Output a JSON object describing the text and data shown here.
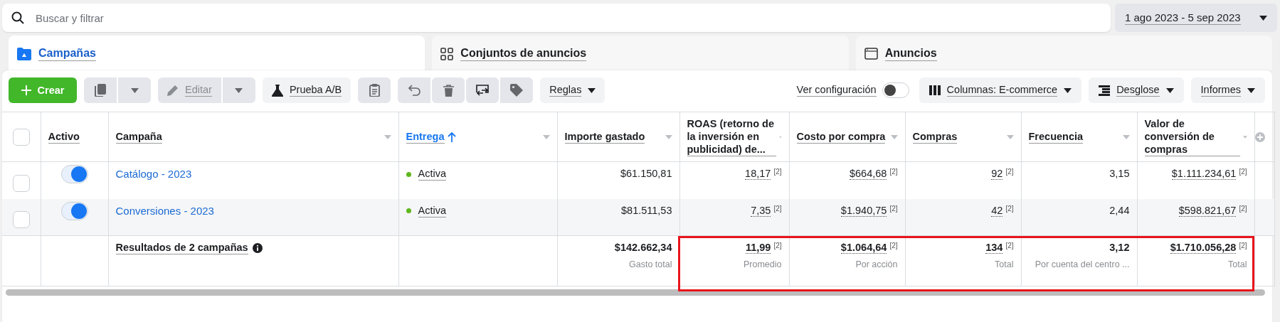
{
  "search": {
    "placeholder": "Buscar y filtrar"
  },
  "date_range": {
    "label": "1 ago 2023 - 5 sep 2023"
  },
  "tabs": [
    {
      "label": "Campañas",
      "selected": true
    },
    {
      "label": "Conjuntos de anuncios",
      "selected": false
    },
    {
      "label": "Anuncios",
      "selected": false
    }
  ],
  "toolbar": {
    "groups": [
      [
        {
          "kind": "create",
          "label": "Crear",
          "disabled": false
        }
      ],
      [
        {
          "kind": "copy",
          "disabled": true
        },
        {
          "kind": "dropdown",
          "disabled": true
        }
      ],
      [
        {
          "kind": "edit",
          "label": "Editar",
          "disabled": true
        },
        {
          "kind": "dropdown",
          "disabled": true
        }
      ],
      [
        {
          "kind": "test",
          "label": "Prueba A/B",
          "disabled": false
        }
      ],
      [
        {
          "kind": "clipboard",
          "disabled": true
        }
      ],
      [
        {
          "kind": "undo",
          "disabled": true
        },
        {
          "kind": "delete",
          "disabled": true
        },
        {
          "kind": "swap",
          "disabled": true
        },
        {
          "kind": "tag",
          "disabled": true
        }
      ],
      [
        {
          "kind": "rules",
          "label": "Reglas",
          "disabled": false
        }
      ]
    ],
    "view_settings": {
      "label": "Ver configuración",
      "on": false
    },
    "right": [
      {
        "kind": "columns",
        "label": "Columnas: E-commerce"
      },
      {
        "kind": "breakdown",
        "label": "Desglose"
      },
      {
        "kind": "reports",
        "label": "Informes"
      }
    ]
  },
  "table": {
    "select_all": {
      "checked": false
    },
    "columns": [
      {
        "label": "Activo",
        "sortable": false,
        "sorted": false
      },
      {
        "label": "Campaña",
        "sortable": true,
        "sorted": false
      },
      {
        "label": "Entrega",
        "sortable": true,
        "sorted": true
      },
      {
        "label": "Importe gastado",
        "sortable": true,
        "sorted": false
      },
      {
        "label": "ROAS (retorno de la inversión en publicidad) de...",
        "sortable": true,
        "sorted": false
      },
      {
        "label": "Costo por compra",
        "sortable": true,
        "sorted": false
      },
      {
        "label": "Compras",
        "sortable": true,
        "sorted": false
      },
      {
        "label": "Frecuencia",
        "sortable": true,
        "sorted": false
      },
      {
        "label": "Valor de conversión de compras",
        "sortable": true,
        "sorted": false
      }
    ],
    "rows": [
      {
        "checked": false,
        "cells": [
          {
            "kind": "toggle",
            "on": true
          },
          {
            "kind": "link",
            "text": "Catálogo - 2023"
          },
          {
            "kind": "status",
            "text": "Activa",
            "color": "#5fb71d"
          },
          {
            "kind": "number",
            "text": "$61.150,81",
            "dotted": false
          },
          {
            "kind": "number",
            "text": "18,17",
            "note": "[2]",
            "dotted": true
          },
          {
            "kind": "number",
            "text": "$664,68",
            "note": "[2]",
            "dotted": true
          },
          {
            "kind": "number",
            "text": "92",
            "note": "[2]",
            "dotted": true
          },
          {
            "kind": "number",
            "text": "3,15",
            "dotted": false
          },
          {
            "kind": "number",
            "text": "$1.111.234,61",
            "note": "[2]",
            "dotted": true
          }
        ]
      },
      {
        "checked": false,
        "cells": [
          {
            "kind": "toggle",
            "on": true
          },
          {
            "kind": "link",
            "text": "Conversiones - 2023"
          },
          {
            "kind": "status",
            "text": "Activa",
            "color": "#5fb71d"
          },
          {
            "kind": "number",
            "text": "$81.511,53",
            "dotted": false
          },
          {
            "kind": "number",
            "text": "7,35",
            "note": "[2]",
            "dotted": true
          },
          {
            "kind": "number",
            "text": "$1.940,75",
            "note": "[2]",
            "dotted": true
          },
          {
            "kind": "number",
            "text": "42",
            "note": "[2]",
            "dotted": true
          },
          {
            "kind": "number",
            "text": "2,44",
            "dotted": false
          },
          {
            "kind": "number",
            "text": "$598.821,67",
            "note": "[2]",
            "dotted": true
          }
        ]
      }
    ],
    "summary": {
      "cells": [
        "",
        {
          "kind": "summary",
          "text": "Resultados de 2 campañas"
        },
        "",
        {
          "kind": "number",
          "text": "$142.662,34",
          "sublabel": "Gasto total",
          "dotted": false,
          "highlighted": false
        },
        {
          "kind": "number",
          "text": "11,99",
          "note": "[2]",
          "sublabel": "Promedio",
          "dotted": true,
          "highlighted": true
        },
        {
          "kind": "number",
          "text": "$1.064,64",
          "note": "[2]",
          "sublabel": "Por acción",
          "dotted": true,
          "highlighted": true
        },
        {
          "kind": "number",
          "text": "134",
          "note": "[2]",
          "sublabel": "Total",
          "dotted": true,
          "highlighted": true
        },
        {
          "kind": "number",
          "text": "3,12",
          "sublabel": "Por cuenta del centro ...",
          "dotted": false,
          "highlighted": true
        },
        {
          "kind": "number",
          "text": "$1.710.056,28",
          "note": "[2]",
          "sublabel": "Total",
          "dotted": true,
          "highlighted": true
        }
      ]
    }
  }
}
